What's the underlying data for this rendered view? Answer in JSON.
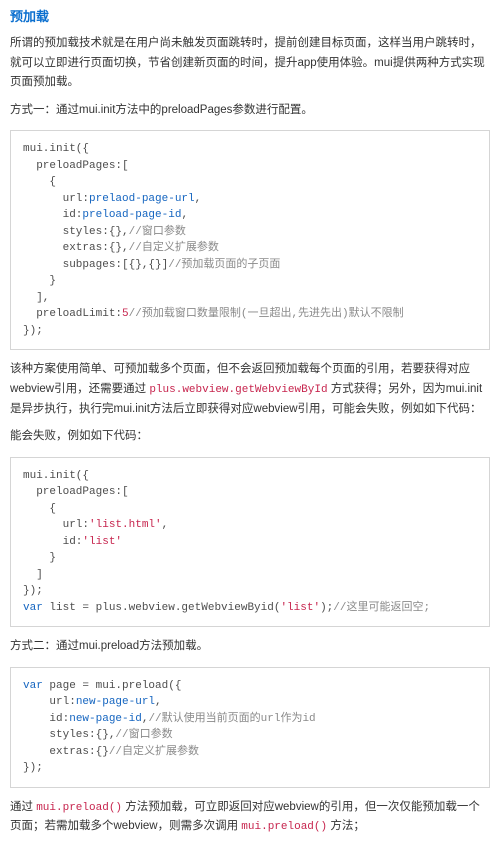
{
  "heading": "预加载",
  "intro": "所谓的预加载技术就是在用户尚未触发页面跳转时，提前创建目标页面，这样当用户跳转时，就可以立即进行页面切换，节省创建新页面的时间，提升app使用体验。mui提供两种方式实现页面预加载。",
  "method1_title": "方式一：通过mui.init方法中的preloadPages参数进行配置。",
  "code1": {
    "l01": "mui.init({",
    "l02": "  preloadPages:[",
    "l03": "    {",
    "l04_a": "      url:",
    "l04_b": "prelaod-page-url",
    "l04_c": ",",
    "l05_a": "      id:",
    "l05_b": "preload-page-id",
    "l05_c": ",",
    "l06_a": "      styles:{},",
    "l06_cmt": "//窗口参数",
    "l07_a": "      extras:{},",
    "l07_cmt": "//自定义扩展参数",
    "l08_a": "      subpages:[{},{}]",
    "l08_cmt": "//预加载页面的子页面",
    "l09": "    }",
    "l10": "  ],",
    "l11_a": "  preloadLimit:",
    "l11_b": "5",
    "l11_cmt": "//预加载窗口数量限制(一旦超出,先进先出)默认不限制",
    "l12": "});"
  },
  "para2_a": "该种方案使用简单、可预加载多个页面，但不会返回预加载每个页面的引用，若要获得对应webview引用，还需要通过",
  "api1": "plus.webview.getWebviewById",
  "para2_b": "方式获得；另外，因为mui.init是异步执行，执行完mui.init方法后立即获得对应webview引用，可能会失败，例如如下代码：",
  "para2_echo": "能会失败，例如如下代码：",
  "code2": {
    "l01": "mui.init({",
    "l02": "  preloadPages:[",
    "l03": "    {",
    "l04_a": "      url:",
    "l04_b": "'list.html'",
    "l04_c": ",",
    "l05_a": "      id:",
    "l05_b": "'list'",
    "l06": "    }",
    "l07": "  ]",
    "l08": "});",
    "l09_a": "var",
    "l09_b": " list = plus.webview.getWebviewByid(",
    "l09_c": "'list'",
    "l09_d": ");",
    "l09_cmt": "//这里可能返回空;"
  },
  "method2_title": "方式二：通过mui.preload方法预加载。",
  "code3": {
    "l01_a": "var",
    "l01_b": " page = mui.preload({",
    "l02_a": "    url:",
    "l02_b": "new-page-url",
    "l02_c": ",",
    "l03_a": "    id:",
    "l03_b": "new-page-id",
    "l03_c": ",",
    "l03_cmt": "//默认使用当前页面的url作为id",
    "l04_a": "    styles:{},",
    "l04_cmt": "//窗口参数",
    "l05_a": "    extras:{}",
    "l05_cmt": "//自定义扩展参数",
    "l06": "});"
  },
  "para3_a": "通过 ",
  "api2": "mui.preload()",
  "para3_b": " 方法预加载，可立即返回对应webview的引用，但一次仅能预加载一个页面；若需加载多个webview，则需多次调用 ",
  "api3": "mui.preload()",
  "para3_c": " 方法；"
}
